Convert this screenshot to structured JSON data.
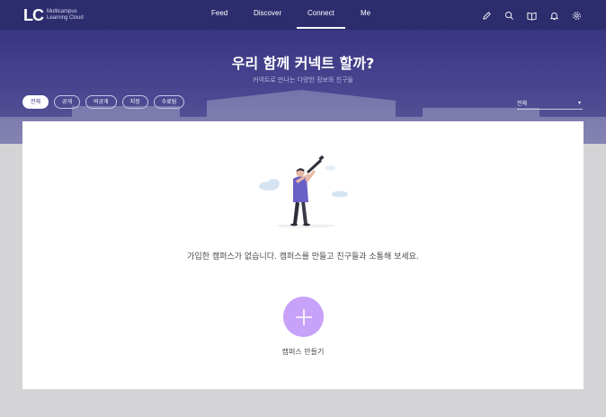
{
  "logo": {
    "mark": "LC",
    "line1": "Multicampus",
    "line2": "Learning Cloud"
  },
  "nav": {
    "links": [
      "Feed",
      "Discover",
      "Connect",
      "Me"
    ],
    "active": "Connect",
    "icons": [
      "pencil-icon",
      "search-icon",
      "book-icon",
      "bell-icon",
      "gear-icon"
    ]
  },
  "hero": {
    "title": "우리 함께 커넥트 할까?",
    "subtitle": "커넥트로 만나는 다양한 정보와 친구들",
    "filters": [
      "전체",
      "공개",
      "비공개",
      "지정",
      "수료됨"
    ],
    "active_filter": "전체",
    "select_value": "전체"
  },
  "empty": {
    "message": "가입한 캠퍼스가 없습니다. 캠퍼스를 만들고 친구들과 소통해 보세요.",
    "add_label": "캠퍼스 만들기"
  },
  "colors": {
    "nav_bg": "#2d2d6e",
    "hero_bg": "#3a3582",
    "accent": "#c8a2f8",
    "page_bg": "#d4d4d6"
  }
}
